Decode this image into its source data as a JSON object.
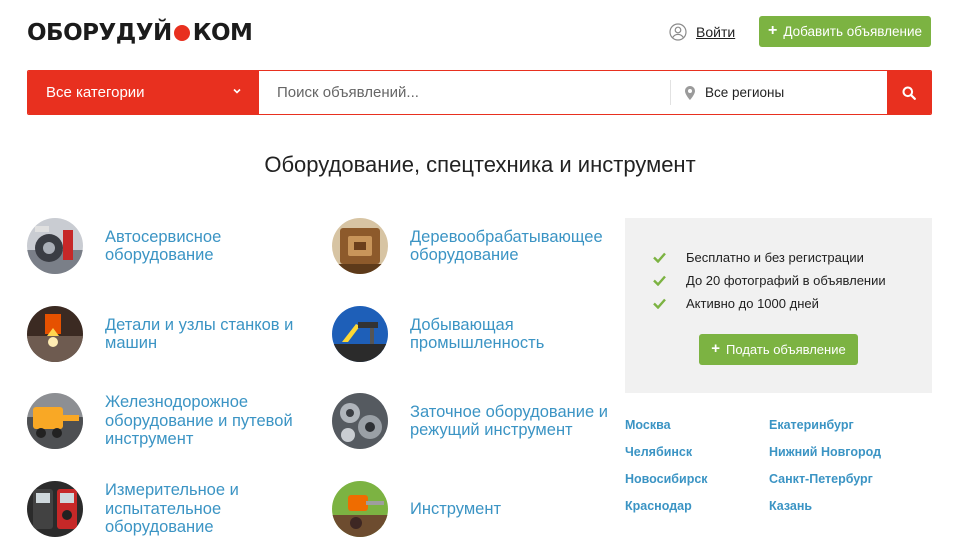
{
  "header": {
    "logo_left": "ОБОРУДУЙ",
    "logo_right": "КОМ",
    "login_label": "Войти",
    "add_ad_label": "Добавить объявление"
  },
  "search": {
    "category_label": "Все категории",
    "placeholder": "Поиск объявлений...",
    "region_label": "Все регионы"
  },
  "page_title": "Оборудование, спецтехника и инструмент",
  "categories": [
    {
      "name": "Автосервисное оборудование"
    },
    {
      "name": "Деревообрабатывающее оборудование"
    },
    {
      "name": "Детали и узлы станков и машин"
    },
    {
      "name": "Добывающая промышленность"
    },
    {
      "name": "Железнодорожное оборудование и путевой инструмент"
    },
    {
      "name": "Заточное оборудование и режущий инструмент"
    },
    {
      "name": "Измерительное и испытательное оборудование"
    },
    {
      "name": "Инструмент"
    }
  ],
  "promo": {
    "features": [
      "Бесплатно и без регистрации",
      "До 20 фотографий в объявлении",
      "Активно до 1000 дней"
    ],
    "post_label": "Подать объявление"
  },
  "cities": [
    "Москва",
    "Екатеринбург",
    "Челябинск",
    "Нижний Новгород",
    "Новосибирск",
    "Санкт-Петербург",
    "Краснодар",
    "Казань"
  ],
  "colors": {
    "brand_red": "#e8301f",
    "accent_green": "#7cb342",
    "link_blue": "#3b94c4"
  }
}
